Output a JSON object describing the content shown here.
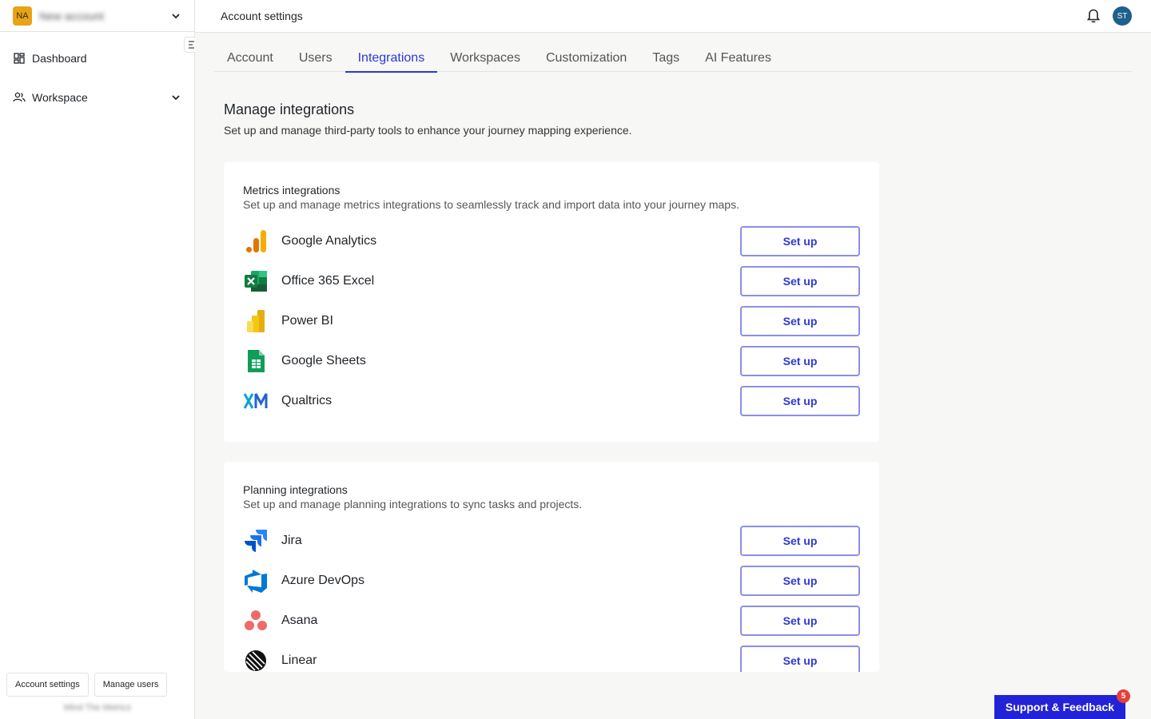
{
  "account": {
    "initials": "NA",
    "name": "New account"
  },
  "sidebar": {
    "items": [
      {
        "label": "Dashboard",
        "icon": "dashboard-grid-icon"
      },
      {
        "label": "Workspace",
        "icon": "users-icon"
      }
    ],
    "bottom_buttons": [
      "Account settings",
      "Manage users"
    ],
    "footer": "Mind The Metrics"
  },
  "topbar": {
    "title": "Account settings",
    "user_initials": "ST"
  },
  "tabs": [
    "Account",
    "Users",
    "Integrations",
    "Workspaces",
    "Customization",
    "Tags",
    "AI Features"
  ],
  "active_tab": "Integrations",
  "page": {
    "title": "Manage integrations",
    "subtitle": "Set up and manage third-party tools to enhance your journey mapping experience."
  },
  "metrics": {
    "title": "Metrics integrations",
    "description": "Set up and manage metrics integrations to seamlessly track and import data into your journey maps.",
    "items": [
      {
        "name": "Google Analytics",
        "button": "Set up",
        "icon": "google-analytics-icon"
      },
      {
        "name": "Office 365 Excel",
        "button": "Set up",
        "icon": "excel-icon"
      },
      {
        "name": "Power BI",
        "button": "Set up",
        "icon": "power-bi-icon"
      },
      {
        "name": "Google Sheets",
        "button": "Set up",
        "icon": "google-sheets-icon"
      },
      {
        "name": "Qualtrics",
        "button": "Set up",
        "icon": "qualtrics-icon"
      }
    ]
  },
  "planning": {
    "title": "Planning integrations",
    "description": "Set up and manage planning integrations to sync tasks and projects.",
    "items": [
      {
        "name": "Jira",
        "button": "Set up",
        "icon": "jira-icon"
      },
      {
        "name": "Azure DevOps",
        "button": "Set up",
        "icon": "azure-devops-icon"
      },
      {
        "name": "Asana",
        "button": "Set up",
        "icon": "asana-icon"
      },
      {
        "name": "Linear",
        "button": "Set up",
        "icon": "linear-icon"
      }
    ]
  },
  "support": {
    "label": "Support & Feedback",
    "badge": "5"
  },
  "colors": {
    "accent": "#2e37d4",
    "button_border": "#8b8fe6",
    "support_bg": "#2222d6",
    "badge": "#e5403a",
    "account_avatar": "#e8a317",
    "user_avatar": "#1f5f8b"
  }
}
